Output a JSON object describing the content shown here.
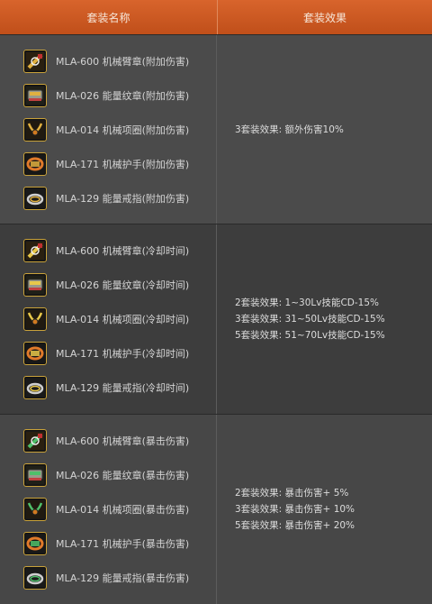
{
  "header": {
    "name": "套装名称",
    "effect": "套装效果"
  },
  "groups": [
    {
      "items": [
        {
          "label": "MLA-600 机械臂章(附加伤害)",
          "icon": "armband-icon"
        },
        {
          "label": "MLA-026 能量纹章(附加伤害)",
          "icon": "emblem-icon"
        },
        {
          "label": "MLA-014 机械项圈(附加伤害)",
          "icon": "necklace-icon"
        },
        {
          "label": "MLA-171 机械护手(附加伤害)",
          "icon": "bracelet-icon"
        },
        {
          "label": "MLA-129 能量戒指(附加伤害)",
          "icon": "ring-icon"
        }
      ],
      "effects": [
        "3套装效果: 额外伤害10%"
      ]
    },
    {
      "items": [
        {
          "label": "MLA-600 机械臂章(冷却时间)",
          "icon": "armband-icon"
        },
        {
          "label": "MLA-026 能量纹章(冷却时间)",
          "icon": "emblem-icon"
        },
        {
          "label": "MLA-014 机械项圈(冷却时间)",
          "icon": "necklace-icon"
        },
        {
          "label": "MLA-171 机械护手(冷却时间)",
          "icon": "bracelet-icon"
        },
        {
          "label": "MLA-129 能量戒指(冷却时间)",
          "icon": "ring-icon"
        }
      ],
      "effects": [
        "2套装效果: 1~30Lv技能CD-15%",
        "3套装效果: 31~50Lv技能CD-15%",
        "5套装效果: 51~70Lv技能CD-15%"
      ]
    },
    {
      "items": [
        {
          "label": "MLA-600 机械臂章(暴击伤害)",
          "icon": "armband-icon"
        },
        {
          "label": "MLA-026 能量纹章(暴击伤害)",
          "icon": "emblem-icon"
        },
        {
          "label": "MLA-014 机械项圈(暴击伤害)",
          "icon": "necklace-icon"
        },
        {
          "label": "MLA-171 机械护手(暴击伤害)",
          "icon": "bracelet-icon"
        },
        {
          "label": "MLA-129 能量戒指(暴击伤害)",
          "icon": "ring-icon"
        }
      ],
      "effects": [
        "2套装效果: 暴击伤害+ 5%",
        "3套装效果: 暴击伤害+ 10%",
        "5套装效果: 暴击伤害+ 20%"
      ]
    }
  ],
  "colors": {
    "header_bg": "#c9551f",
    "icon_border": "#c9a23a",
    "group1_accent": "#e0b040",
    "group2_accent": "#e8c84a",
    "group3_accent": "#4fbf6a"
  }
}
